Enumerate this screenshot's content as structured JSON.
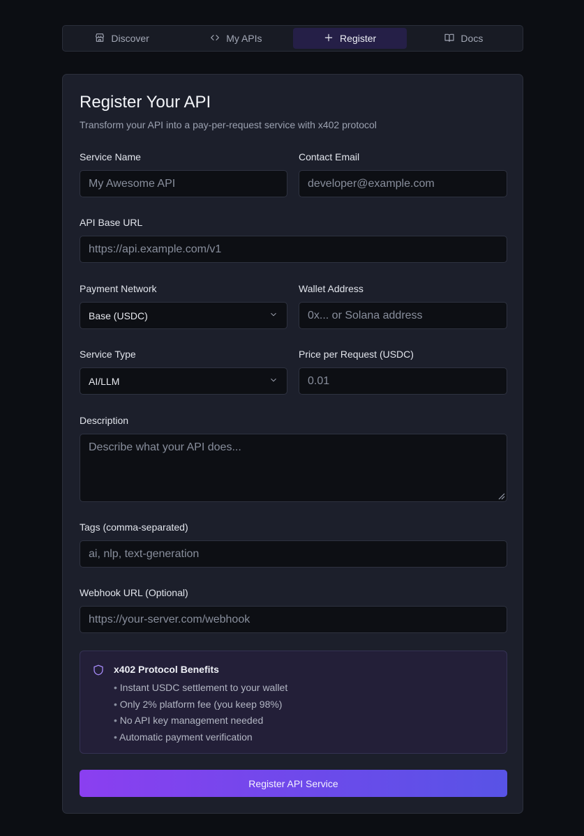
{
  "nav": {
    "tabs": [
      {
        "label": "Discover",
        "icon": "store-icon",
        "active": false
      },
      {
        "label": "My APIs",
        "icon": "code-icon",
        "active": false
      },
      {
        "label": "Register",
        "icon": "plus-icon",
        "active": true
      },
      {
        "label": "Docs",
        "icon": "book-icon",
        "active": false
      }
    ]
  },
  "form": {
    "title": "Register Your API",
    "subtitle": "Transform your API into a pay-per-request service with x402 protocol",
    "service_name": {
      "label": "Service Name",
      "placeholder": "My Awesome API"
    },
    "contact_email": {
      "label": "Contact Email",
      "placeholder": "developer@example.com"
    },
    "api_base_url": {
      "label": "API Base URL",
      "placeholder": "https://api.example.com/v1"
    },
    "payment_network": {
      "label": "Payment Network",
      "value": "Base (USDC)"
    },
    "wallet_address": {
      "label": "Wallet Address",
      "placeholder": "0x... or Solana address"
    },
    "service_type": {
      "label": "Service Type",
      "value": "AI/LLM"
    },
    "price": {
      "label": "Price per Request (USDC)",
      "placeholder": "0.01"
    },
    "description": {
      "label": "Description",
      "placeholder": "Describe what your API does..."
    },
    "tags": {
      "label": "Tags (comma-separated)",
      "placeholder": "ai, nlp, text-generation"
    },
    "webhook": {
      "label": "Webhook URL (Optional)",
      "placeholder": "https://your-server.com/webhook"
    },
    "benefits": {
      "title": "x402 Protocol Benefits",
      "items": [
        "Instant USDC settlement to your wallet",
        "Only 2% platform fee (you keep 98%)",
        "No API key management needed",
        "Automatic payment verification"
      ]
    },
    "submit_label": "Register API Service"
  },
  "colors": {
    "background": "#0c0e13",
    "card": "#1c1f2b",
    "accent_start": "#8b3ff0",
    "accent_end": "#5853e6",
    "active_tab": "#251f47"
  }
}
